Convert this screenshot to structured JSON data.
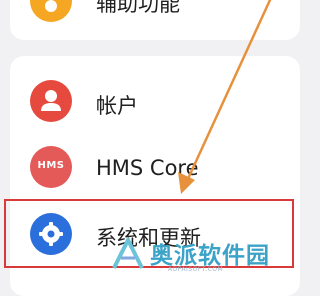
{
  "settings": {
    "items": [
      {
        "label": "辅助功能",
        "icon": "accessibility-icon",
        "color": "#f5a623"
      },
      {
        "label": "帐户",
        "icon": "account-icon",
        "color": "#e64a3f"
      },
      {
        "label": "HMS Core",
        "icon": "hms-core-icon",
        "icon_text": "HMS",
        "color": "#e35a58"
      },
      {
        "label": "系统和更新",
        "icon": "gear-icon",
        "color": "#2a6fdb"
      }
    ]
  },
  "annotation": {
    "highlight_color": "#d83a3a",
    "arrow_color": "#e8913c"
  },
  "watermark": {
    "name": "奥派软件园",
    "url": "AOPAISOFT.COM",
    "color": "#3ba3c8"
  }
}
